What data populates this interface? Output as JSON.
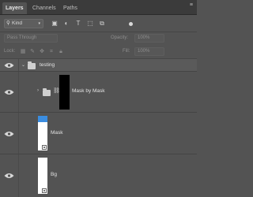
{
  "tabs": [
    {
      "label": "Layers",
      "active": true
    },
    {
      "label": "Channels",
      "active": false
    },
    {
      "label": "Paths",
      "active": false
    }
  ],
  "filter": {
    "kind_label": "Kind",
    "icons": [
      "pixel-filter-icon",
      "adjustment-filter-icon",
      "type-filter-icon",
      "shape-filter-icon",
      "smart-object-filter-icon"
    ]
  },
  "blend": {
    "mode": "Pass Through",
    "opacity_label": "Opacity:",
    "opacity_value": "100%"
  },
  "lock": {
    "label": "Lock:",
    "fill_label": "Fill:",
    "fill_value": "100%"
  },
  "layers": [
    {
      "name": "testing",
      "type": "group",
      "expanded": true
    },
    {
      "name": "Mask by Mask",
      "type": "group",
      "expanded": false
    },
    {
      "name": "Mask",
      "type": "smart-object"
    },
    {
      "name": "Bg",
      "type": "smart-object"
    }
  ],
  "colors": {
    "panel_bg": "#535353",
    "tab_bar_bg": "#3b3b3b",
    "thumb_blue": "#3b8de0"
  }
}
